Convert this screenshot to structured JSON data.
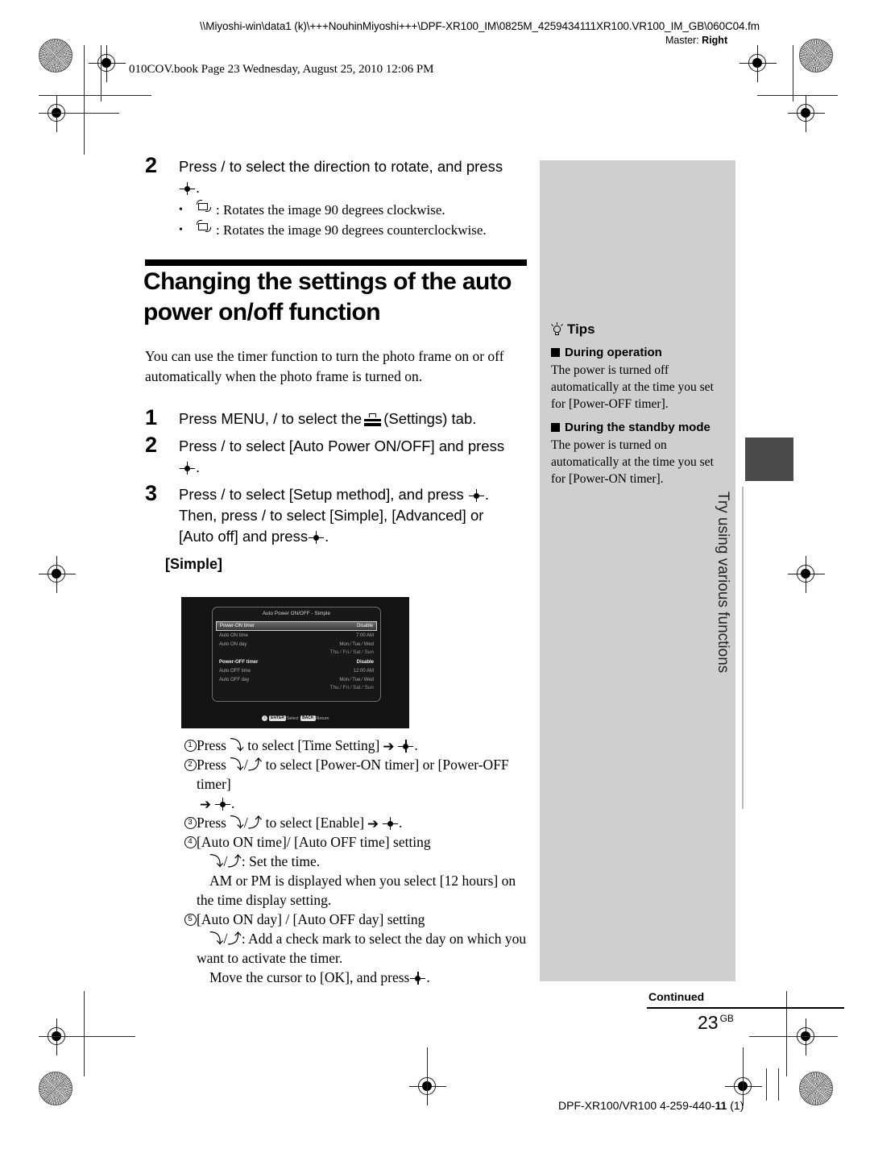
{
  "header": {
    "file_path": "\\\\Miyoshi-win\\data1 (k)\\+++NouhinMiyoshi+++\\DPF-XR100_IM\\0825M_4259434111XR100.VR100_IM_GB\\060C04.fm",
    "master_label": "Master:",
    "master_value": "Right",
    "book_line": "010COV.book  Page 23  Wednesday, August 25, 2010  12:06 PM"
  },
  "top_step": {
    "number": "2",
    "text_before_icon": "Press  /  to select the direction to rotate, and press",
    "text_after_icon": ".",
    "bullets": [
      {
        "icon": "rotate-cw-icon",
        "text": ": Rotates the image 90 degrees clockwise."
      },
      {
        "icon": "rotate-ccw-icon",
        "text": ": Rotates the image 90 degrees counterclockwise."
      }
    ]
  },
  "heading": "Changing the settings of the auto power on/off function",
  "intro": "You can use the timer function to turn the photo frame on or off automatically when the photo frame is turned on.",
  "steps": [
    {
      "number": "1",
      "part1": "Press MENU,  /  to select the",
      "part2": "(Settings) tab."
    },
    {
      "number": "2",
      "part1": "Press  /  to select [Auto Power ON/OFF] and press",
      "part2": "."
    },
    {
      "number": "3",
      "part1": "Press  /  to select [Setup method], and press",
      "part2": ".",
      "part3": "Then, press  /  to select [Simple],  [Advanced] or",
      "part4": "[Auto off] and press",
      "part5": "."
    }
  ],
  "simple_label": "[Simple]",
  "lcd": {
    "title": "Auto Power ON/OFF - Simple",
    "rows": [
      {
        "label": "Power-ON timer",
        "value": "Disable",
        "selected": true,
        "bold": false
      },
      {
        "label": "Auto ON time",
        "value": "7:00 AM",
        "selected": false,
        "bold": false
      },
      {
        "label": "Auto ON day",
        "value": "",
        "selected": false,
        "bold": false
      },
      {
        "label": "Power-OFF timer",
        "value": "Disable",
        "selected": false,
        "bold": true
      },
      {
        "label": "Auto OFF time",
        "value": "12:00 AM",
        "selected": false,
        "bold": false
      },
      {
        "label": "Auto OFF day",
        "value": "",
        "selected": false,
        "bold": false
      }
    ],
    "days_row1": "Mon  ⁄  Tue  ⁄  Wed",
    "days_row2": "Thu  ⁄  Fri  ⁄  Sat  ⁄  Sun",
    "bottom_bar": {
      "key1": "↕",
      "key2": "ENTER",
      "action1": "Select",
      "key3": "BACK",
      "action2": "Return"
    }
  },
  "circled_list": [
    {
      "num": "1",
      "line1_a": "Press ",
      "line1_b": " to select [Time Setting]",
      "line1_c": "."
    },
    {
      "num": "2",
      "line1_a": "Press ",
      "line1_b": " to select [Power-ON timer] or [Power-OFF timer]",
      "line1_c": "."
    },
    {
      "num": "3",
      "line1_a": "Press ",
      "line1_b": " to select [Enable]",
      "line1_c": "."
    },
    {
      "num": "4",
      "line1_b": "[Auto ON time]/ [Auto OFF time] setting",
      "sub1": ":  Set the time.",
      "sub2": "AM or PM is displayed when you select [12 hours] on the time display setting."
    },
    {
      "num": "5",
      "line1_b": "[Auto ON day] / [Auto OFF day] setting",
      "sub1": ": Add a check mark to select the day on which you want to activate the timer.",
      "sub2": "Move the cursor to [OK], and press",
      "sub3": "."
    }
  ],
  "tips": {
    "title": "Tips",
    "sections": [
      {
        "heading": "During operation",
        "body": "The power is turned off automatically at the time you set for [Power-OFF timer]."
      },
      {
        "heading": "During the standby mode",
        "body": "The power is turned on automatically at the time you set for [Power-ON timer]."
      }
    ]
  },
  "side_tab_text": "Try using various functions",
  "footer": {
    "continued": "Continued",
    "page": "23",
    "page_sup": "GB",
    "part_a": "DPF-XR100/VR100 4-259-440-",
    "part_b": "11",
    "part_c": " (1)"
  }
}
